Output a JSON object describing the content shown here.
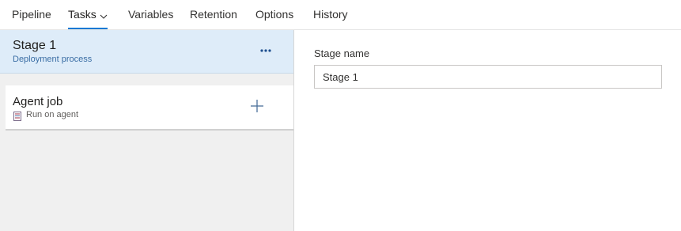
{
  "tabs": [
    {
      "label": "Pipeline"
    },
    {
      "label": "Tasks"
    },
    {
      "label": "Variables"
    },
    {
      "label": "Retention"
    },
    {
      "label": "Options"
    },
    {
      "label": "History"
    }
  ],
  "active_tab": "Tasks",
  "colors": {
    "accent": "#0078d4",
    "stage_header_bg": "#deecf9",
    "subtext_blue": "#3b6ea5"
  },
  "stage": {
    "title": "Stage 1",
    "subtitle": "Deployment process",
    "more_icon": "ellipsis-icon"
  },
  "agent_job": {
    "title": "Agent job",
    "subtitle": "Run on agent",
    "agent_icon": "server-icon",
    "add_icon": "plus-icon"
  },
  "form": {
    "stage_name_label": "Stage name",
    "stage_name_value": "Stage 1"
  }
}
